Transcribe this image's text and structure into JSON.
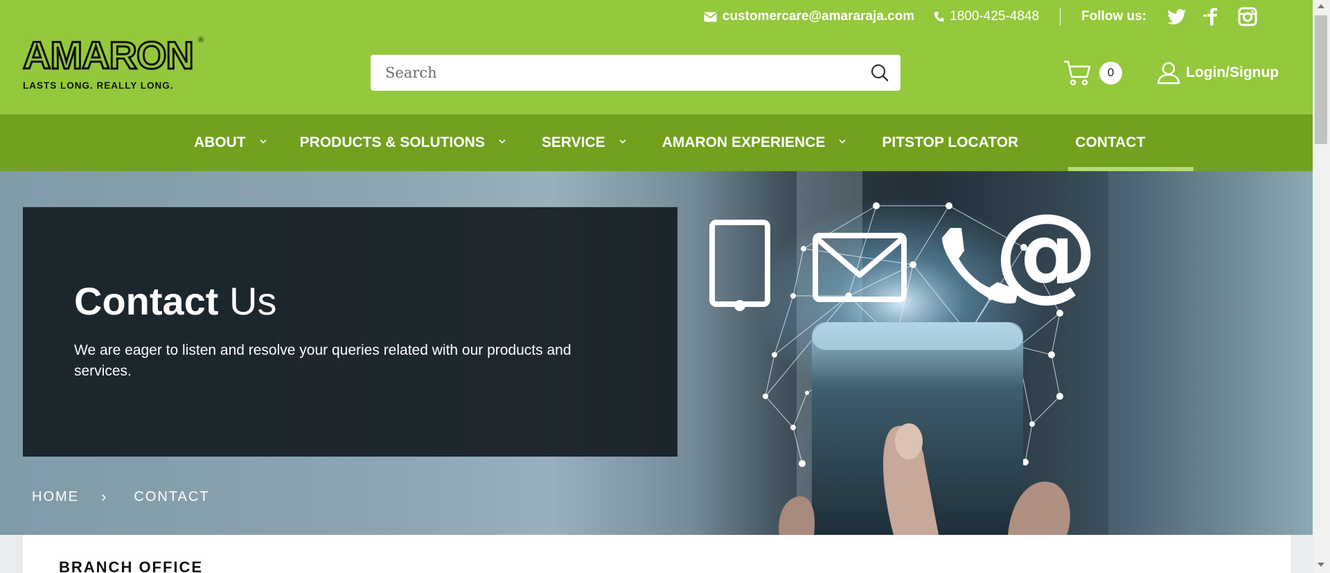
{
  "topbar": {
    "email": "customercare@amararaja.com",
    "phone": "1800-425-4848",
    "follow_label": "Follow us:",
    "social": [
      "twitter-icon",
      "facebook-icon",
      "instagram-icon"
    ]
  },
  "logo": {
    "word": "AMARON",
    "registered": "®",
    "tagline": "LASTS LONG. REALLY LONG."
  },
  "search": {
    "placeholder": "Search"
  },
  "cart": {
    "count": "0"
  },
  "account": {
    "login_label": "Login/Signup"
  },
  "nav": {
    "items": [
      {
        "label": "ABOUT",
        "dropdown": true
      },
      {
        "label": "PRODUCTS & SOLUTIONS",
        "dropdown": true
      },
      {
        "label": "SERVICE",
        "dropdown": true
      },
      {
        "label": "AMARON EXPERIENCE",
        "dropdown": true
      },
      {
        "label": "PITSTOP LOCATOR",
        "dropdown": false
      },
      {
        "label": "CONTACT",
        "dropdown": false,
        "active": true
      }
    ]
  },
  "hero": {
    "title_bold": "Contact",
    "title_light": " Us",
    "text": "We are eager to listen and resolve your queries related with our products and services."
  },
  "breadcrumb": {
    "home": "HOME",
    "separator": "›",
    "current": "CONTACT"
  },
  "branch": {
    "title": "BRANCH OFFICE"
  },
  "colors": {
    "header_green": "#94c83d",
    "nav_green": "#73a11e",
    "active_underline": "#b5dd6b"
  }
}
